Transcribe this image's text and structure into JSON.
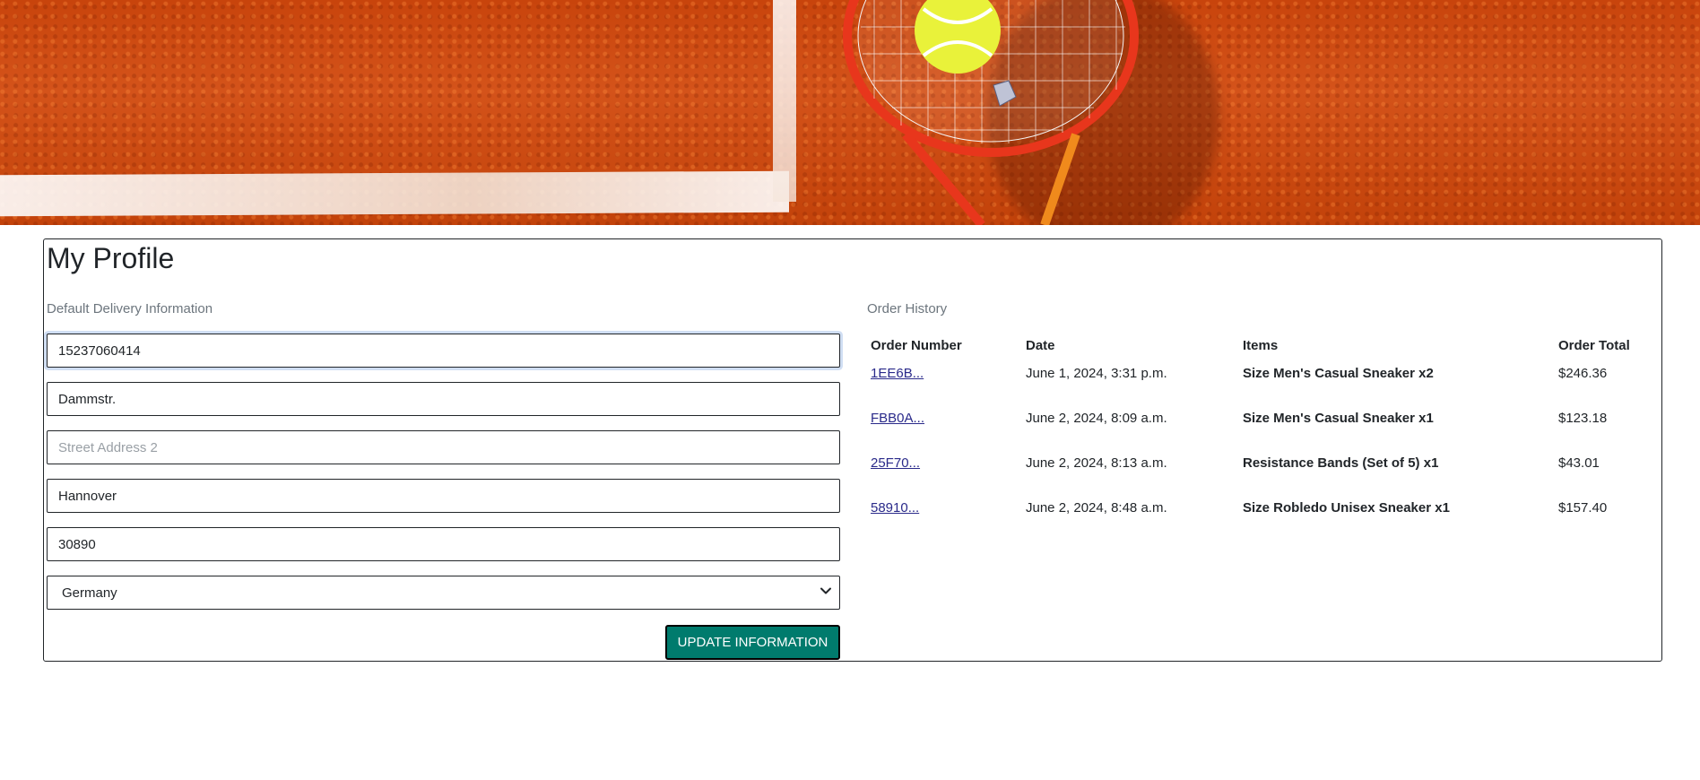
{
  "page": {
    "title": "My Profile"
  },
  "delivery": {
    "section_label": "Default Delivery Information",
    "phone": "15237060414",
    "street1": "Dammstr.",
    "street2": "",
    "street2_placeholder": "Street Address 2",
    "city": "Hannover",
    "postcode": "30890",
    "country": "Germany",
    "update_button": "UPDATE INFORMATION"
  },
  "orders": {
    "section_label": "Order History",
    "headers": {
      "number": "Order Number",
      "date": "Date",
      "items": "Items",
      "total": "Order Total"
    },
    "rows": [
      {
        "number": "1EE6B...",
        "date": "June 1, 2024, 3:31 p.m.",
        "items": "Size Men's Casual Sneaker x2",
        "total": "$246.36"
      },
      {
        "number": "FBB0A...",
        "date": "June 2, 2024, 8:09 a.m.",
        "items": "Size Men's Casual Sneaker x1",
        "total": "$123.18"
      },
      {
        "number": "25F70...",
        "date": "June 2, 2024, 8:13 a.m.",
        "items": "Resistance Bands (Set of 5) x1",
        "total": "$43.01"
      },
      {
        "number": "58910...",
        "date": "June 2, 2024, 8:48 a.m.",
        "items": "Size Robledo Unisex Sneaker x1",
        "total": "$157.40"
      }
    ]
  },
  "colors": {
    "accent_button": "#007b6d",
    "link": "#2a2a8a",
    "clay_court": "#c8440c"
  }
}
